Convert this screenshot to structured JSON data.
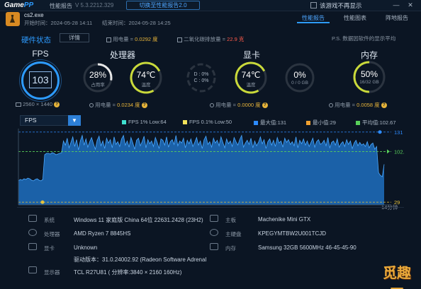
{
  "app": {
    "logo_a": "Game",
    "logo_b": "PP",
    "nav_report": "性能报告",
    "version": "V 5.3.2212.329",
    "switch_label": "切换至性能报告2.0",
    "no_remind_label": "该游戏不再显示"
  },
  "game": {
    "name": "cs2.exe",
    "start": "开始时间：2024-05-28 14:11",
    "end": "结束时间：2024-05-28 14:25"
  },
  "tabs": [
    "性能报告",
    "性能图表",
    "阵地报告"
  ],
  "hardware": {
    "title": "硬件状态",
    "detail_button": "详情",
    "power_label": "用电量 = ",
    "power_value": "0.0292 度",
    "carbon_label": "二氧化碳排放量 = ",
    "carbon_value": "22.9 克",
    "note": "P.S. 数据因软件的显示平均"
  },
  "gauges": {
    "fps": {
      "title": "FPS",
      "value": "103",
      "resolution": "2560 × 1440"
    },
    "cpu": {
      "title": "处理器",
      "usage_value": "28%",
      "usage_label": "占用率",
      "usage_fraction": 0.28,
      "temp_value": "74℃",
      "temp_label": "温度",
      "power_label": "用电量 = ",
      "power_value": "0.0234 度"
    },
    "gpu": {
      "title": "显卡",
      "d_line1": "D : 0%",
      "d_line2": "C : 0%",
      "temp_value": "74℃",
      "temp_label": "温度",
      "vram_value": "0%",
      "vram_sub": "0 / 0 GB",
      "power_label": "用电量 = ",
      "power_value": "0.0000 度"
    },
    "memory": {
      "title": "内存",
      "usage_value": "50%",
      "usage_sub": "16/32 GB",
      "usage_fraction": 0.5,
      "power_label": "用电量 = ",
      "power_value": "0.0058 度"
    }
  },
  "chart_data": {
    "type": "area",
    "metric_select": "FPS",
    "legend": [
      {
        "label": "FPS 1% Low:64",
        "color": "#3fe0d0"
      },
      {
        "label": "FPS 0.1% Low:50",
        "color": "#f2e25a"
      },
      {
        "label": "最大值:131",
        "color": "#2d8bff"
      },
      {
        "label": "最小值:29",
        "color": "#f0a030"
      },
      {
        "label": "平均值:102.67",
        "color": "#58d05a"
      }
    ],
    "y_ticks": [
      131,
      102.67,
      29
    ],
    "ylim": [
      25,
      136
    ],
    "x_label": "14分钟",
    "max": 131,
    "avg": 102.67,
    "min": 29,
    "values": [
      60,
      62,
      61,
      63,
      62,
      64,
      63,
      61,
      60,
      62,
      63,
      61,
      60,
      62,
      98,
      100,
      100,
      99,
      101,
      100,
      98,
      99,
      100,
      101,
      118,
      112,
      122,
      108,
      116,
      124,
      110,
      120,
      105,
      118,
      126,
      112,
      121,
      109,
      117,
      123,
      114,
      106,
      119,
      125,
      111,
      118,
      107,
      122,
      115,
      120,
      108,
      124,
      113,
      117,
      110,
      121,
      126,
      112,
      118,
      109,
      123,
      115,
      106,
      119,
      122,
      111,
      117,
      125,
      108,
      120,
      114,
      118,
      110,
      123,
      116,
      107,
      121,
      119,
      112,
      124,
      109,
      117,
      120,
      113,
      126,
      111,
      118,
      115,
      122,
      108,
      119,
      114,
      121,
      110,
      116,
      123,
      112,
      118,
      107,
      120,
      125,
      113,
      117,
      109,
      122,
      115,
      119,
      111,
      124,
      116,
      108,
      121,
      114,
      118,
      110,
      123,
      117,
      112,
      120,
      126,
      109,
      115,
      119,
      113,
      122,
      108,
      118,
      111,
      116,
      124,
      114,
      120,
      107,
      117,
      121,
      112,
      119,
      110,
      123,
      115,
      118,
      109,
      122,
      116,
      120,
      113,
      117,
      111,
      124,
      108,
      119,
      114,
      121,
      112,
      118,
      110,
      116,
      122,
      109,
      117,
      120,
      113,
      115,
      119,
      111,
      123,
      108,
      116,
      118,
      112,
      121,
      109,
      114,
      117,
      110,
      120,
      113,
      118,
      107,
      115,
      119,
      111,
      116,
      112,
      114,
      110,
      117,
      108,
      113,
      115,
      106,
      110,
      72,
      68,
      66,
      84
    ]
  },
  "system": {
    "os_label": "系统",
    "os_value": "Windows 11 家庭版 China 64位 22631.2428 (23H2)",
    "cpu_label": "处理器",
    "cpu_value": "AMD Ryzen 7 8845HS",
    "gpu_label": "显卡",
    "gpu_value": "Unknown",
    "driver_value": "驱动版本：31.0.24002.92 (Radeon Software Adrenal",
    "monitor_label": "显示器",
    "monitor_value": "TCL R27U81 ( 分辨率:3840 × 2160 160Hz)",
    "board_label": "主板",
    "board_value": "Machenike Mini GTX",
    "mainboard_label": "主硬盘",
    "mainboard_value": "KPEGYMTBW2U001TCJD",
    "memory_label": "内存",
    "memory_value": "Samsung 32GB 5600MHz 46-45-45-90"
  },
  "watermark": "觅趣网"
}
